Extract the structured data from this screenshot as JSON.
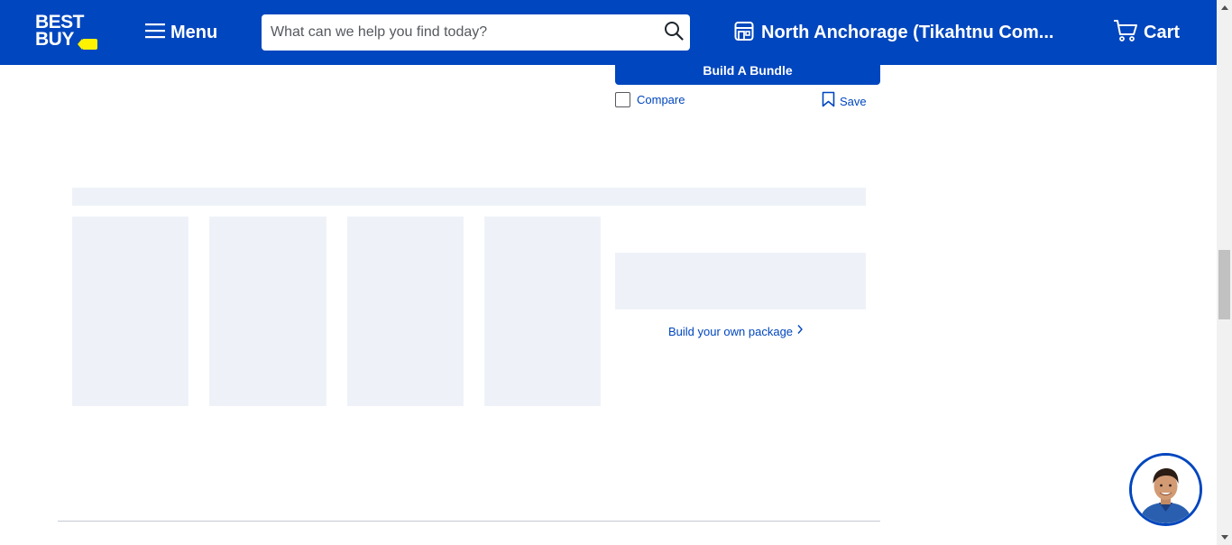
{
  "header": {
    "logo_text": "BEST BUY",
    "menu_label": "Menu",
    "search_placeholder": "What can we help you find today?",
    "store_label": "North Anchorage (Tikahtnu Com...",
    "cart_label": "Cart"
  },
  "product_actions": {
    "bundle_button": "Build A Bundle",
    "compare_label": "Compare",
    "save_label": "Save"
  },
  "package": {
    "link_label": "Build your own package"
  },
  "colors": {
    "brand_blue": "#0046be",
    "brand_yellow": "#fff200",
    "skeleton": "#eef2f8"
  },
  "icons": [
    "menu-icon",
    "search-icon",
    "store-icon",
    "cart-icon",
    "bookmark-icon",
    "chevron-right-icon"
  ]
}
